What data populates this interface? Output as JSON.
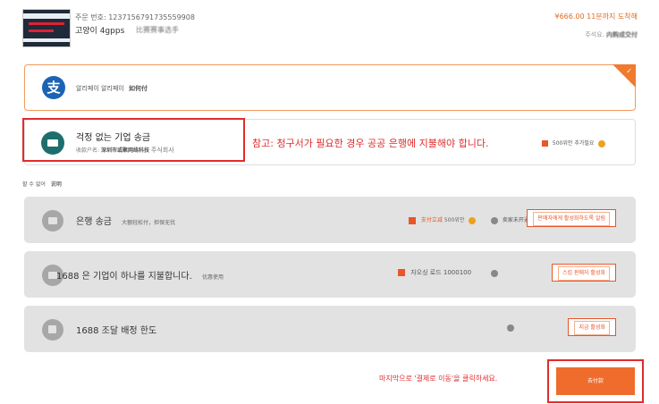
{
  "order": {
    "number_label": "주문 번호: 1237156791735559908",
    "product_name": "고양이 4gpps",
    "product_extra": "比赛赛事选手",
    "price_deadline": "¥666.00 11분까지 도착해",
    "remark_label": "주석요.",
    "remark_value": "内购成交付"
  },
  "payment_methods": {
    "alipay": {
      "icon_char": "支",
      "label": "알리페이 알리페이",
      "label_extra": "如何付",
      "selected": true,
      "check": "✓"
    },
    "corporate": {
      "title": "걱정 없는 기업 송금",
      "sub_label": "收款户名:",
      "sub_blurred": "深圳市或聚网络科技",
      "sub_suffix": "주식회사",
      "note": "참고: 청구서가 필요한 경우 공공 은행에 지불해야 합니다.",
      "fee_text": "500위안 추가필요"
    }
  },
  "unavailable": {
    "label": "할 수 없어",
    "extra": "说明"
  },
  "disabled_methods": [
    {
      "title": "은행 송금",
      "note": "大额轻松付，担保无忧",
      "mid_text": "支付立减",
      "mid_extra": "500위안",
      "status": "卖家未开通",
      "button": "판매자에게 활성화하도록 알림"
    },
    {
      "title": "1688 은 기업이 하나를 지불합니다.",
      "note": "优惠使用",
      "mid_text": "자오싱 로드 1000100",
      "mid_extra": "",
      "status": "",
      "button": "스킵 판매자 활성화"
    },
    {
      "title": "1688 조달 배정 한도",
      "note": "",
      "mid_text": "",
      "mid_extra": "",
      "status": "",
      "button": "지금 활성화"
    }
  ],
  "footer": {
    "hint": "마지막으로 '결제로 이동'을 클릭하세요.",
    "pay_button": "去付款"
  },
  "colors": {
    "accent": "#ef6c2d",
    "highlight": "#e12b2b",
    "alipay": "#1b64b5"
  }
}
